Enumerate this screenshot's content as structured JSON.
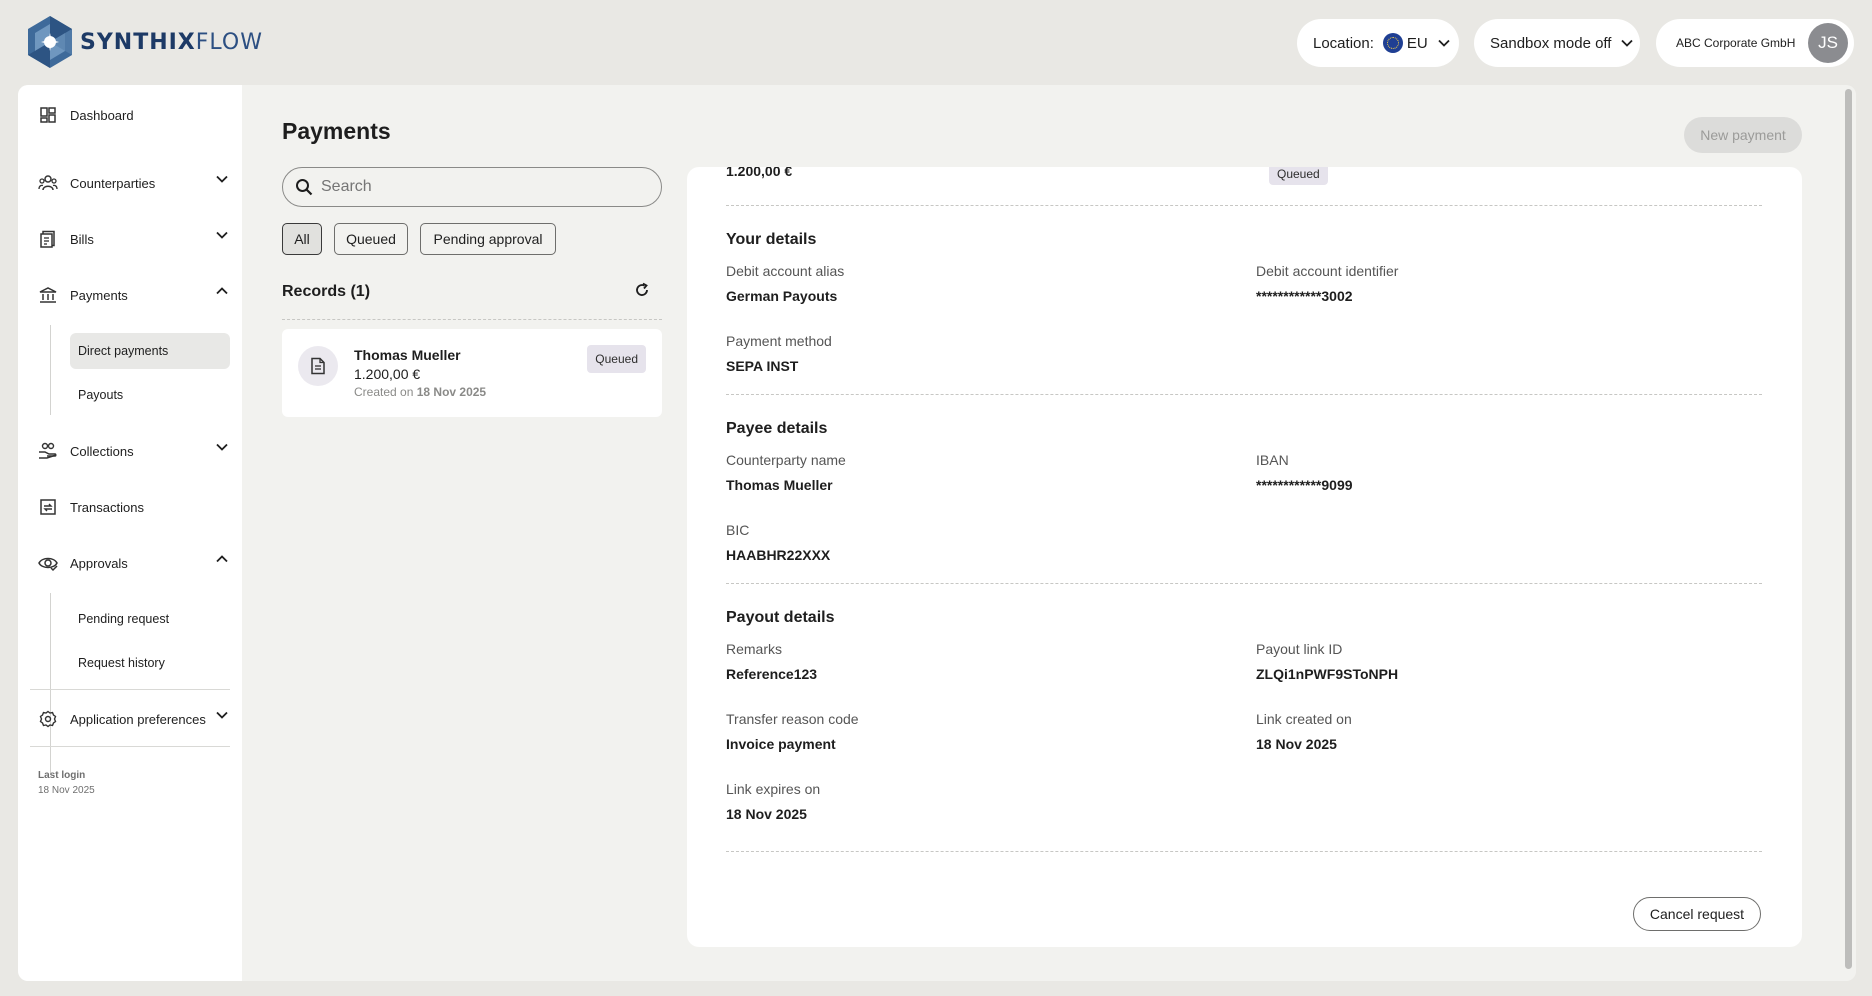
{
  "header": {
    "brand_bold": "SYNTHIX",
    "brand_light": "FLOW",
    "location_label": "Location:",
    "location_value": "EU",
    "sandbox_label": "Sandbox mode off",
    "company": "ABC Corporate GmbH",
    "avatar_initials": "JS"
  },
  "sidebar": {
    "dashboard": "Dashboard",
    "counterparties": "Counterparties",
    "bills": "Bills",
    "payments": "Payments",
    "payments_sub": [
      "Direct payments",
      "Payouts"
    ],
    "collections": "Collections",
    "transactions": "Transactions",
    "approvals": "Approvals",
    "approvals_sub": [
      "Pending request",
      "Request history"
    ],
    "app_prefs": "Application preferences",
    "last_login_label": "Last login",
    "last_login_value": "18 Nov 2025"
  },
  "main": {
    "title": "Payments",
    "search_placeholder": "Search",
    "filters": [
      "All",
      "Queued",
      "Pending approval"
    ],
    "records_title": "Records (1)",
    "new_payment": "New payment",
    "record": {
      "name": "Thomas Mueller",
      "amount": "1.200,00 €",
      "created_prefix": "Created on",
      "created_date": "18 Nov 2025",
      "status": "Queued"
    }
  },
  "detail": {
    "top_amount": "1.200,00 €",
    "top_status": "Queued",
    "your_details": {
      "title": "Your details",
      "debit_alias_label": "Debit account alias",
      "debit_alias_value": "German Payouts",
      "debit_id_label": "Debit account identifier",
      "debit_id_value": "************3002",
      "method_label": "Payment method",
      "method_value": "SEPA INST"
    },
    "payee_details": {
      "title": "Payee details",
      "cp_name_label": "Counterparty name",
      "cp_name_value": "Thomas Mueller",
      "iban_label": "IBAN",
      "iban_value": "************9099",
      "bic_label": "BIC",
      "bic_value": "HAABHR22XXX"
    },
    "payout_details": {
      "title": "Payout details",
      "remarks_label": "Remarks",
      "remarks_value": "Reference123",
      "link_id_label": "Payout link ID",
      "link_id_value": "ZLQi1nPWF9SToNPH",
      "reason_label": "Transfer reason code",
      "reason_value": "Invoice payment",
      "link_created_label": "Link created on",
      "link_created_value": "18 Nov 2025",
      "link_expires_label": "Link expires on",
      "link_expires_value": "18 Nov 2025"
    },
    "cancel": "Cancel request"
  }
}
